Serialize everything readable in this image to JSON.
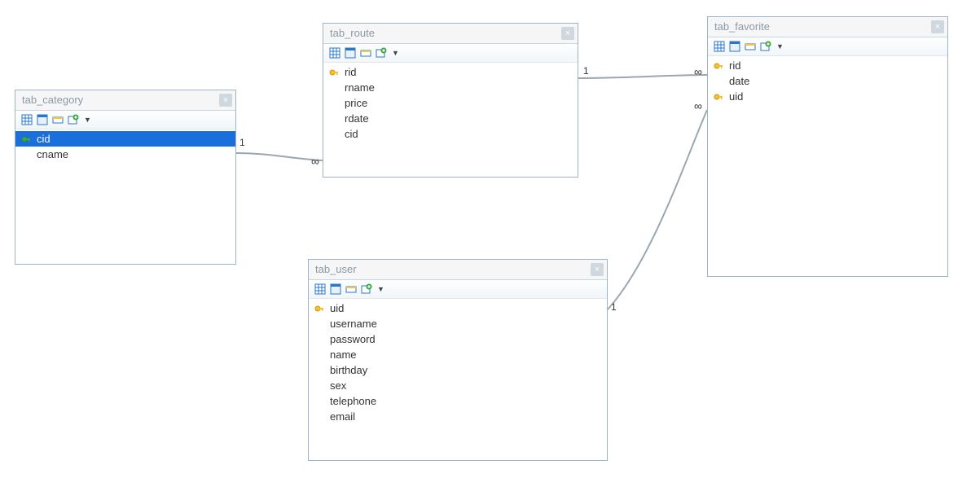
{
  "tables": {
    "category": {
      "title": "tab_category",
      "columns": [
        {
          "name": "cid",
          "key": true,
          "selected": true
        },
        {
          "name": "cname",
          "key": false,
          "selected": false
        }
      ]
    },
    "route": {
      "title": "tab_route",
      "columns": [
        {
          "name": "rid",
          "key": true,
          "selected": false
        },
        {
          "name": "rname",
          "key": false,
          "selected": false
        },
        {
          "name": "price",
          "key": false,
          "selected": false
        },
        {
          "name": "rdate",
          "key": false,
          "selected": false
        },
        {
          "name": "cid",
          "key": false,
          "selected": false
        }
      ]
    },
    "favorite": {
      "title": "tab_favorite",
      "columns": [
        {
          "name": "rid",
          "key": true,
          "selected": false
        },
        {
          "name": "date",
          "key": false,
          "selected": false
        },
        {
          "name": "uid",
          "key": true,
          "selected": false
        }
      ]
    },
    "user": {
      "title": "tab_user",
      "columns": [
        {
          "name": "uid",
          "key": true,
          "selected": false
        },
        {
          "name": "username",
          "key": false,
          "selected": false
        },
        {
          "name": "password",
          "key": false,
          "selected": false
        },
        {
          "name": "name",
          "key": false,
          "selected": false
        },
        {
          "name": "birthday",
          "key": false,
          "selected": false
        },
        {
          "name": "sex",
          "key": false,
          "selected": false
        },
        {
          "name": "telephone",
          "key": false,
          "selected": false
        },
        {
          "name": "email",
          "key": false,
          "selected": false
        }
      ]
    }
  },
  "relations": [
    {
      "from": "category",
      "to": "route",
      "from_card": "1",
      "to_card": "∞"
    },
    {
      "from": "route",
      "to": "favorite",
      "from_card": "1",
      "to_card": "∞"
    },
    {
      "from": "user",
      "to": "favorite",
      "from_card": "1",
      "to_card": "∞"
    }
  ],
  "labels": {
    "rel_cat_route_one": "1",
    "rel_cat_route_many": "∞",
    "rel_route_fav_one": "1",
    "rel_route_fav_many": "∞",
    "rel_user_fav_one": "1",
    "rel_user_fav_many": "∞"
  },
  "icons": {
    "close": "×",
    "dropdown": "▼"
  }
}
